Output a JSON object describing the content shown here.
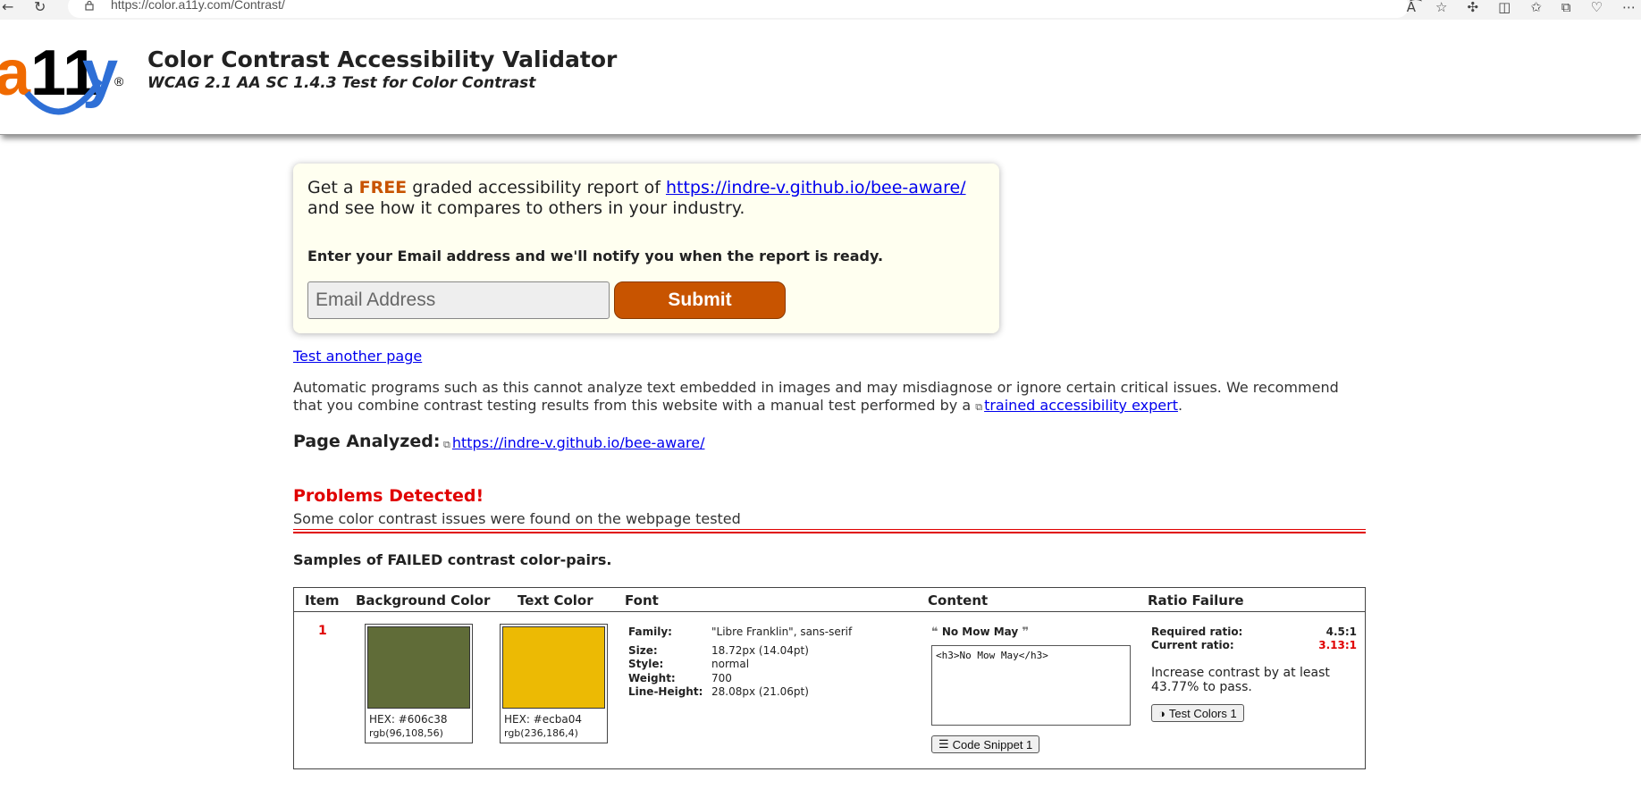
{
  "browser": {
    "url": "https://color.a11y.com/Contrast/"
  },
  "header": {
    "logo_text": "a11y",
    "title": "Color Contrast Accessibility Validator",
    "subtitle": "WCAG 2.1 AA SC 1.4.3 Test for Color Contrast"
  },
  "promo": {
    "get_a": "Get a",
    "free": "FREE",
    "report_text": "graded accessibility report of",
    "report_url": "https://indre-v.github.io/bee-aware/",
    "compare_text": "and see how it compares to others in your industry.",
    "notify_text": "Enter your Email address and we'll notify you when the report is ready.",
    "email_placeholder": "Email Address",
    "submit_label": "Submit"
  },
  "links": {
    "test_another": "Test another page"
  },
  "disclaimer": {
    "text": "Automatic programs such as this cannot analyze text embedded in images and may misdiagnose or ignore certain critical issues. We recommend that you combine contrast testing results from this website with a manual test performed by a",
    "expert_link": "trained accessibility expert",
    "end": "."
  },
  "analyzed": {
    "label": "Page Analyzed:",
    "url": "https://indre-v.github.io/bee-aware/"
  },
  "problems": {
    "title": "Problems Detected!",
    "description": "Some color contrast issues were found on the webpage tested"
  },
  "samples": {
    "title": "Samples of FAILED contrast color-pairs."
  },
  "table": {
    "headers": {
      "item": "Item",
      "background": "Background Color",
      "text_color": "Text Color",
      "font": "Font",
      "content": "Content",
      "ratio": "Ratio Failure"
    },
    "rows": [
      {
        "item": "1",
        "bg_color": "#606c38",
        "bg_hex": "HEX: #606c38",
        "bg_rgb": "rgb(96,108,56)",
        "text_color": "#ecba04",
        "text_hex": "HEX: #ecba04",
        "text_rgb": "rgb(236,186,4)",
        "font_family_label": "Family:",
        "font_family": "\"Libre Franklin\", sans-serif",
        "size_label": "Size:",
        "size": "18.72px (14.04pt)",
        "style_label": "Style:",
        "style": "normal",
        "weight_label": "Weight:",
        "weight": "700",
        "line_height_label": "Line-Height:",
        "line_height": "28.08px (21.06pt)",
        "content_label": "No Mow May",
        "snippet": "<h3>No Mow May</h3>",
        "code_snippet_button": "Code Snippet 1",
        "required_label": "Required ratio:",
        "required_value": "4.5:1",
        "current_label": "Current ratio:",
        "current_value": "3.13:1",
        "increase_text": "Increase contrast by at least 43.77% to pass.",
        "test_colors_button": "Test Colors 1"
      }
    ]
  },
  "colors": {
    "brand_orange": "#c85400",
    "logo_blue": "#2e6fd6",
    "error_red": "#e00000",
    "link_blue": "#0000ee"
  },
  "icons": {
    "back": "back-arrow-icon",
    "reload": "reload-icon",
    "lock": "lock-icon",
    "read_aloud": "read-aloud-icon",
    "favorite": "star-icon",
    "extensions": "puzzle-icon",
    "split": "split-screen-icon",
    "favorites": "favorites-icon",
    "collections": "collections-icon",
    "health": "browser-health-icon",
    "more": "more-icon",
    "external": "external-link-icon",
    "quote_open": "quote-open-icon",
    "quote_close": "quote-close-icon",
    "code": "code-lines-icon",
    "contrast": "contrast-half-icon"
  }
}
